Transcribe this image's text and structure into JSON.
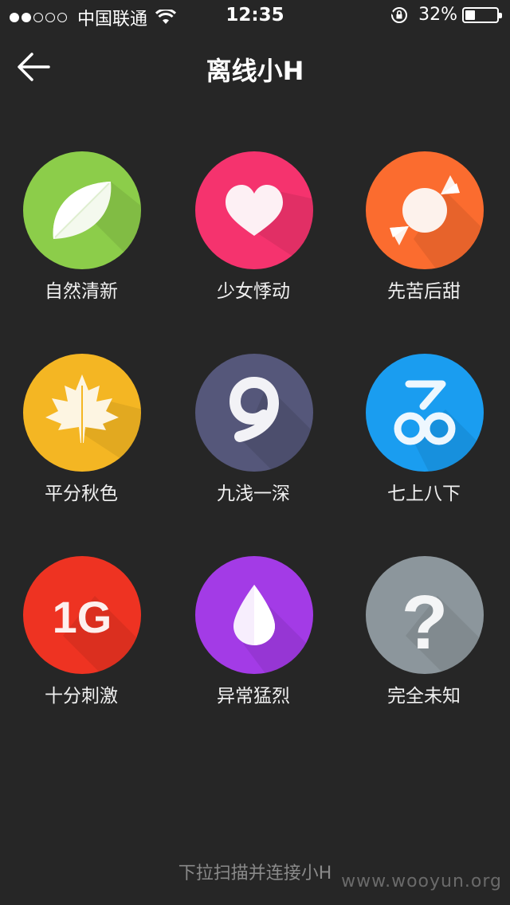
{
  "status_bar": {
    "signal_dots": "●●○○○",
    "carrier": "中国联通",
    "time": "12:35",
    "battery_percent": "32%",
    "battery_level": 0.32
  },
  "nav": {
    "title": "离线小H",
    "back_icon": "arrow-left-icon"
  },
  "modes": [
    {
      "label": "自然清新",
      "color": "#8ccd4a",
      "icon": "leaf-icon"
    },
    {
      "label": "少女悸动",
      "color": "#f5336e",
      "icon": "heart-icon"
    },
    {
      "label": "先苦后甜",
      "color": "#fb6c2f",
      "icon": "candy-icon"
    },
    {
      "label": "平分秋色",
      "color": "#f4b623",
      "icon": "maple-leaf-icon"
    },
    {
      "label": "九浅一深",
      "color": "#55577a",
      "icon": "nine-icon"
    },
    {
      "label": "七上八下",
      "color": "#1a9df0",
      "icon": "seven-eight-icon"
    },
    {
      "label": "十分刺激",
      "color": "#ee3322",
      "icon": "1g-icon"
    },
    {
      "label": "异常猛烈",
      "color": "#a33be6",
      "icon": "drop-icon"
    },
    {
      "label": "完全未知",
      "color": "#8c969c",
      "icon": "question-icon"
    }
  ],
  "icon_text": {
    "one_g": "1G",
    "question": "?"
  },
  "footer": {
    "hint": "下拉扫描并连接小H"
  },
  "watermark": "www.wooyun.org"
}
